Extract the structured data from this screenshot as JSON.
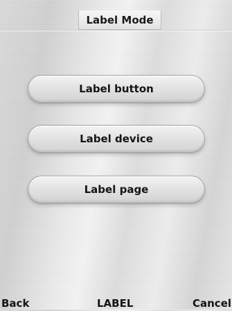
{
  "header": {
    "title": "Label Mode"
  },
  "menu": {
    "items": [
      {
        "label": "Label button"
      },
      {
        "label": "Label device"
      },
      {
        "label": "Label page"
      }
    ]
  },
  "softkeys": {
    "left": "Back",
    "center": "LABEL",
    "right": "Cancel"
  },
  "colors": {
    "text": "#151515",
    "button_border": "#a7a7a7",
    "background": "#dcdcdc"
  }
}
